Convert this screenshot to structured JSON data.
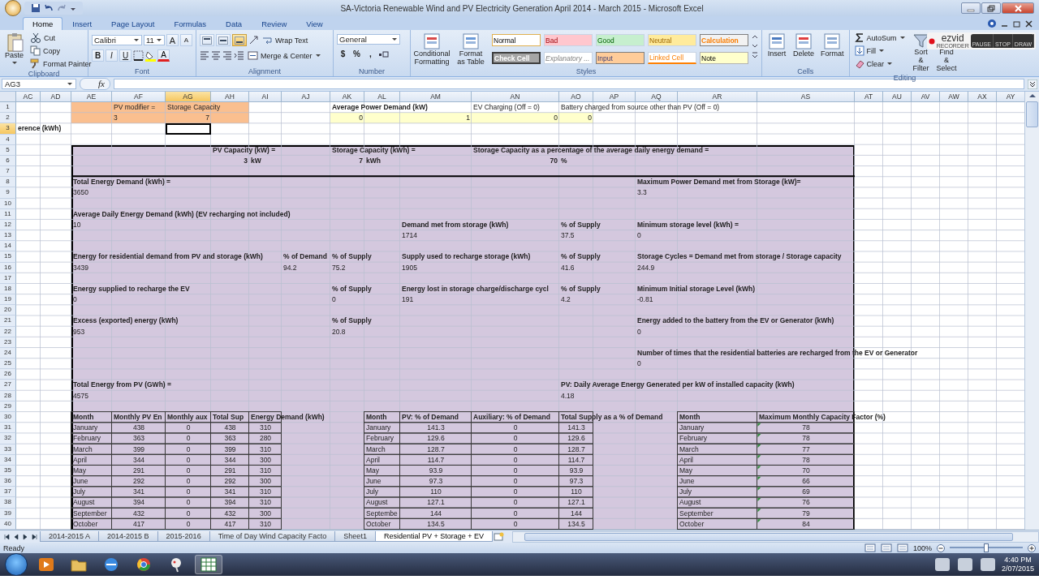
{
  "window": {
    "title": "SA-Victoria Renewable Wind and PV Electricity Generation April 2014 - March 2015 - Microsoft Excel"
  },
  "ribbon_tabs": [
    {
      "label": "Home",
      "selected": true
    },
    {
      "label": "Insert",
      "selected": false
    },
    {
      "label": "Page Layout",
      "selected": false
    },
    {
      "label": "Formulas",
      "selected": false
    },
    {
      "label": "Data",
      "selected": false
    },
    {
      "label": "Review",
      "selected": false
    },
    {
      "label": "View",
      "selected": false
    }
  ],
  "ribbon": {
    "clipboard": {
      "label": "Clipboard",
      "paste": "Paste",
      "actions": [
        "Cut",
        "Copy",
        "Format Painter"
      ]
    },
    "font": {
      "label": "Font",
      "family": "Calibri",
      "size": "11",
      "size_buttons": [
        "A",
        "A"
      ],
      "format_buttons": [
        "B",
        "I",
        "U"
      ],
      "font_color": "A"
    },
    "alignment": {
      "label": "Alignment",
      "vertical_align": [
        {
          "selected": false
        },
        {
          "selected": false
        },
        {
          "selected": true
        }
      ],
      "wrap": "Wrap Text",
      "merge": "Merge & Center"
    },
    "number": {
      "label": "Number",
      "format": "General",
      "symbols": [
        "$",
        "%",
        ","
      ]
    },
    "styles": {
      "label": "Styles",
      "buttons": [
        "Conditional Formatting",
        "Format as Table"
      ],
      "cell_styles": [
        {
          "label": "Normal",
          "kind": "normal"
        },
        {
          "label": "Bad",
          "kind": "bad"
        },
        {
          "label": "Good",
          "kind": "good"
        },
        {
          "label": "Neutral",
          "kind": "neutral"
        },
        {
          "label": "Calculation",
          "kind": "calculation"
        },
        {
          "label": "Check Cell",
          "kind": "check"
        },
        {
          "label": "Explanatory ...",
          "kind": "explanatory"
        },
        {
          "label": "Input",
          "kind": "input"
        },
        {
          "label": "Linked Cell",
          "kind": "linked"
        },
        {
          "label": "Note",
          "kind": "note"
        }
      ]
    },
    "cells": {
      "label": "Cells",
      "buttons": [
        "Insert",
        "Delete",
        "Format"
      ]
    },
    "editing": {
      "label": "Editing",
      "actions": [
        "AutoSum",
        "Fill",
        "Clear"
      ],
      "buttons": [
        "Sort & Filter",
        "Find & Select"
      ]
    }
  },
  "recorder": {
    "logo": "ezvid",
    "caption": "RECORDER",
    "buttons": [
      "PAUSE",
      "STOP",
      "DRAW"
    ]
  },
  "formula_bar": {
    "name_box": "AG3",
    "function_label": "fx"
  },
  "columns": [
    {
      "label": "AC",
      "selected": false
    },
    {
      "label": "AD",
      "selected": false
    },
    {
      "label": "AE",
      "selected": false
    },
    {
      "label": "AF",
      "selected": false
    },
    {
      "label": "AG",
      "selected": true
    },
    {
      "label": "AH",
      "selected": false
    },
    {
      "label": "AI",
      "selected": false
    },
    {
      "label": "AJ",
      "selected": false
    },
    {
      "label": "AK",
      "selected": false
    },
    {
      "label": "AL",
      "selected": false
    },
    {
      "label": "AM",
      "selected": false
    },
    {
      "label": "AN",
      "selected": false
    },
    {
      "label": "AO",
      "selected": false
    },
    {
      "label": "AP",
      "selected": false
    },
    {
      "label": "AQ",
      "selected": false
    },
    {
      "label": "AR",
      "selected": false
    },
    {
      "label": "AS",
      "selected": false
    },
    {
      "label": "AT",
      "selected": false
    },
    {
      "label": "AU",
      "selected": false
    },
    {
      "label": "AV",
      "selected": false
    },
    {
      "label": "AW",
      "selected": false
    },
    {
      "label": "AX",
      "selected": false
    },
    {
      "label": "AY",
      "selected": false
    }
  ],
  "rows": [
    {
      "label": "1",
      "selected": false,
      "cells": {
        "AE": {
          "kind": "fill",
          "color": "#fabf8f"
        },
        "AF": {
          "text": "PV modifier =",
          "kind": "text",
          "color": "#fabf8f"
        },
        "AG": {
          "text": "Storage Capacity",
          "kind": "text",
          "color": "#fabf8f"
        },
        "AH": {
          "kind": "fill",
          "color": "#fabf8f"
        },
        "AK": {
          "text": "Average Power Demand (kW)",
          "kind": "label"
        },
        "AN": {
          "text": "EV Charging (Off = 0)",
          "kind": "text"
        },
        "AO": {
          "text": "Battery charged from source other than PV (Off = 0)",
          "kind": "text"
        }
      }
    },
    {
      "label": "2",
      "selected": false,
      "cells": {
        "AE": {
          "kind": "fill",
          "color": "#fabf8f"
        },
        "AF": {
          "text": "3",
          "kind": "text",
          "color": "#fabf8f"
        },
        "AG": {
          "text": "7",
          "kind": "number",
          "color": "#fabf8f"
        },
        "AH": {
          "kind": "fill",
          "color": "#fabf8f"
        },
        "AK": {
          "text": "0",
          "kind": "number",
          "color": "#ffffcc"
        },
        "AL": {
          "kind": "fill",
          "color": "#ffffcc"
        },
        "AM": {
          "text": "1",
          "kind": "number",
          "color": "#ffffcc"
        },
        "AN": {
          "text": "0",
          "kind": "number",
          "color": "#ffffcc"
        },
        "AO": {
          "text": "0",
          "kind": "number",
          "color": "#ffffcc"
        }
      }
    },
    {
      "label": "3",
      "selected": true,
      "cells": {
        "AC": {
          "text": "erence (kWh)",
          "kind": "label"
        }
      }
    },
    {
      "label": "4",
      "selected": false
    },
    {
      "label": "5",
      "selected": false,
      "cells": {
        "AH": {
          "text": "PV Capacity (kW) =",
          "kind": "label"
        },
        "AK": {
          "text": "Storage Capacity (kWh) =",
          "kind": "label"
        },
        "AN": {
          "text": "Storage Capacity as a percentage of the average daily energy demand =",
          "kind": "label"
        }
      }
    },
    {
      "label": "6",
      "selected": false,
      "cells": {
        "AH": {
          "text": "3",
          "kind": "total"
        },
        "AI": {
          "text": "kW",
          "kind": "label"
        },
        "AK": {
          "text": "7",
          "kind": "total"
        },
        "AL": {
          "text": "kWh",
          "kind": "label"
        },
        "AN": {
          "text": "70",
          "kind": "total"
        },
        "AO": {
          "text": "%",
          "kind": "label"
        }
      }
    },
    {
      "label": "7",
      "selected": false
    },
    {
      "label": "8",
      "selected": false,
      "cells": {
        "AE": {
          "text": "Total Energy Demand (kWh) =",
          "kind": "label"
        },
        "AQ": {
          "text": "Maximum Power Demand met from Storage (kW)=",
          "kind": "label"
        }
      }
    },
    {
      "label": "9",
      "selected": false,
      "cells": {
        "AE": {
          "text": "3650",
          "kind": "text"
        },
        "AQ": {
          "text": "3.3",
          "kind": "text"
        }
      }
    },
    {
      "label": "10",
      "selected": false
    },
    {
      "label": "11",
      "selected": false,
      "cells": {
        "AE": {
          "text": "Average Daily Energy Demand (kWh) (EV recharging not included)",
          "kind": "label"
        }
      }
    },
    {
      "label": "12",
      "selected": false,
      "cells": {
        "AE": {
          "text": "10",
          "kind": "text"
        },
        "AM": {
          "text": "Demand met from storage (kWh)",
          "kind": "label"
        },
        "AO": {
          "text": "% of Supply",
          "kind": "label"
        },
        "AQ": {
          "text": "Minimum storage level (kWh) =",
          "kind": "label"
        }
      }
    },
    {
      "label": "13",
      "selected": false,
      "cells": {
        "AM": {
          "text": "1714",
          "kind": "text"
        },
        "AO": {
          "text": "37.5",
          "kind": "text"
        },
        "AQ": {
          "text": "0",
          "kind": "text"
        }
      }
    },
    {
      "label": "14",
      "selected": false
    },
    {
      "label": "15",
      "selected": false,
      "cells": {
        "AE": {
          "text": "Energy for residential demand from PV and storage (kWh)",
          "kind": "label"
        },
        "AJ": {
          "text": "% of Demand",
          "kind": "label"
        },
        "AK": {
          "text": "% of Supply",
          "kind": "label"
        },
        "AM": {
          "text": "Supply used to recharge storage (kWh)",
          "kind": "label"
        },
        "AO": {
          "text": "% of Supply",
          "kind": "label"
        },
        "AQ": {
          "text": "Storage Cycles = Demand met from storage / Storage capacity",
          "kind": "label"
        }
      }
    },
    {
      "label": "16",
      "selected": false,
      "cells": {
        "AE": {
          "text": "3439",
          "kind": "text"
        },
        "AJ": {
          "text": "94.2",
          "kind": "text"
        },
        "AK": {
          "text": "75.2",
          "kind": "text"
        },
        "AM": {
          "text": "1905",
          "kind": "text"
        },
        "AO": {
          "text": "41.6",
          "kind": "text"
        },
        "AQ": {
          "text": "244.9",
          "kind": "text"
        }
      }
    },
    {
      "label": "17",
      "selected": false
    },
    {
      "label": "18",
      "selected": false,
      "cells": {
        "AE": {
          "text": "Energy supplied to recharge the EV",
          "kind": "label"
        },
        "AK": {
          "text": "% of Supply",
          "kind": "label"
        },
        "AM": {
          "text": "Energy lost in storage charge/discharge cycl",
          "kind": "label"
        },
        "AO": {
          "text": "% of Supply",
          "kind": "label"
        },
        "AQ": {
          "text": "Minimum Initial storage Level (kWh)",
          "kind": "label"
        }
      }
    },
    {
      "label": "19",
      "selected": false,
      "cells": {
        "AE": {
          "text": "0",
          "kind": "text"
        },
        "AK": {
          "text": "0",
          "kind": "text"
        },
        "AM": {
          "text": "191",
          "kind": "text"
        },
        "AO": {
          "text": "4.2",
          "kind": "text"
        },
        "AQ": {
          "text": "-0.81",
          "kind": "text"
        }
      }
    },
    {
      "label": "20",
      "selected": false
    },
    {
      "label": "21",
      "selected": false,
      "cells": {
        "AE": {
          "text": "Excess (exported) energy (kWh)",
          "kind": "label"
        },
        "AK": {
          "text": "% of Supply",
          "kind": "label"
        },
        "AQ": {
          "text": "Energy added to the battery from the EV or Generator (kWh)",
          "kind": "label"
        }
      }
    },
    {
      "label": "22",
      "selected": false,
      "cells": {
        "AE": {
          "text": "953",
          "kind": "text"
        },
        "AK": {
          "text": "20.8",
          "kind": "text"
        },
        "AQ": {
          "text": "0",
          "kind": "text"
        }
      }
    },
    {
      "label": "23",
      "selected": false
    },
    {
      "label": "24",
      "selected": false,
      "cells": {
        "AQ": {
          "text": "Number of times that the residential batteries are recharged from the EV or Generator",
          "kind": "label"
        }
      }
    },
    {
      "label": "25",
      "selected": false,
      "cells": {
        "AQ": {
          "text": "0",
          "kind": "text"
        }
      }
    },
    {
      "label": "26",
      "selected": false
    },
    {
      "label": "27",
      "selected": false,
      "cells": {
        "AE": {
          "text": "Total Energy from PV (GWh) =",
          "kind": "label"
        },
        "AO": {
          "text": "PV: Daily Average Energy Generated per kW of installed capacity (kWh)",
          "kind": "label"
        }
      }
    },
    {
      "label": "28",
      "selected": false,
      "cells": {
        "AE": {
          "text": "4575",
          "kind": "text"
        },
        "AO": {
          "text": "4.18",
          "kind": "text"
        }
      }
    },
    {
      "label": "29",
      "selected": false
    },
    {
      "label": "30",
      "selected": false,
      "cells": {
        "AE": {
          "text": "Month",
          "kind": "head"
        },
        "AF": {
          "text": "Monthly PV En",
          "kind": "head"
        },
        "AG": {
          "text": "Monthly aux",
          "kind": "head"
        },
        "AH": {
          "text": "Total Sup",
          "kind": "head"
        },
        "AI": {
          "text": "Energy Demand (kWh)",
          "kind": "head"
        },
        "AL": {
          "text": "Month",
          "kind": "head"
        },
        "AM": {
          "text": "PV: % of Demand",
          "kind": "head"
        },
        "AN": {
          "text": "Auxiliary: % of Demand",
          "kind": "head"
        },
        "AO": {
          "text": "Total Supply as a % of Demand",
          "kind": "head"
        },
        "AR": {
          "text": "Month",
          "kind": "head"
        },
        "AS": {
          "text": "Maximum Monthly Capacity Factor (%)",
          "kind": "head"
        }
      }
    },
    {
      "label": "31",
      "selected": false,
      "cells": {
        "AE": {
          "text": "January",
          "kind": "entry"
        },
        "AF": {
          "text": "438",
          "kind": "figure"
        },
        "AG": {
          "text": "0",
          "kind": "figure"
        },
        "AH": {
          "text": "438",
          "kind": "figure"
        },
        "AI": {
          "text": "310",
          "kind": "figure"
        },
        "AL": {
          "text": "January",
          "kind": "entry"
        },
        "AM": {
          "text": "141.3",
          "kind": "figure"
        },
        "AN": {
          "text": "0",
          "kind": "figure"
        },
        "AO": {
          "text": "141.3",
          "kind": "figure"
        },
        "AR": {
          "text": "January",
          "kind": "entry"
        },
        "AS": {
          "text": "78",
          "kind": "flagged"
        }
      }
    },
    {
      "label": "32",
      "selected": false,
      "cells": {
        "AE": {
          "text": "February",
          "kind": "entry"
        },
        "AF": {
          "text": "363",
          "kind": "figure"
        },
        "AG": {
          "text": "0",
          "kind": "figure"
        },
        "AH": {
          "text": "363",
          "kind": "figure"
        },
        "AI": {
          "text": "280",
          "kind": "figure"
        },
        "AL": {
          "text": "February",
          "kind": "entry"
        },
        "AM": {
          "text": "129.6",
          "kind": "figure"
        },
        "AN": {
          "text": "0",
          "kind": "figure"
        },
        "AO": {
          "text": "129.6",
          "kind": "figure"
        },
        "AR": {
          "text": "February",
          "kind": "entry"
        },
        "AS": {
          "text": "78",
          "kind": "flagged"
        }
      }
    },
    {
      "label": "33",
      "selected": false,
      "cells": {
        "AE": {
          "text": "March",
          "kind": "entry"
        },
        "AF": {
          "text": "399",
          "kind": "figure"
        },
        "AG": {
          "text": "0",
          "kind": "figure"
        },
        "AH": {
          "text": "399",
          "kind": "figure"
        },
        "AI": {
          "text": "310",
          "kind": "figure"
        },
        "AL": {
          "text": "March",
          "kind": "entry"
        },
        "AM": {
          "text": "128.7",
          "kind": "figure"
        },
        "AN": {
          "text": "0",
          "kind": "figure"
        },
        "AO": {
          "text": "128.7",
          "kind": "figure"
        },
        "AR": {
          "text": "March",
          "kind": "entry"
        },
        "AS": {
          "text": "77",
          "kind": "flagged"
        }
      }
    },
    {
      "label": "34",
      "selected": false,
      "cells": {
        "AE": {
          "text": "April",
          "kind": "entry"
        },
        "AF": {
          "text": "344",
          "kind": "figure"
        },
        "AG": {
          "text": "0",
          "kind": "figure"
        },
        "AH": {
          "text": "344",
          "kind": "figure"
        },
        "AI": {
          "text": "300",
          "kind": "figure"
        },
        "AL": {
          "text": "April",
          "kind": "entry"
        },
        "AM": {
          "text": "114.7",
          "kind": "figure"
        },
        "AN": {
          "text": "0",
          "kind": "figure"
        },
        "AO": {
          "text": "114.7",
          "kind": "figure"
        },
        "AR": {
          "text": "April",
          "kind": "entry"
        },
        "AS": {
          "text": "78",
          "kind": "flagged"
        }
      }
    },
    {
      "label": "35",
      "selected": false,
      "cells": {
        "AE": {
          "text": "May",
          "kind": "entry"
        },
        "AF": {
          "text": "291",
          "kind": "figure"
        },
        "AG": {
          "text": "0",
          "kind": "figure"
        },
        "AH": {
          "text": "291",
          "kind": "figure"
        },
        "AI": {
          "text": "310",
          "kind": "figure"
        },
        "AL": {
          "text": "May",
          "kind": "entry"
        },
        "AM": {
          "text": "93.9",
          "kind": "figure"
        },
        "AN": {
          "text": "0",
          "kind": "figure"
        },
        "AO": {
          "text": "93.9",
          "kind": "figure"
        },
        "AR": {
          "text": "May",
          "kind": "entry"
        },
        "AS": {
          "text": "70",
          "kind": "flagged"
        }
      }
    },
    {
      "label": "36",
      "selected": false,
      "cells": {
        "AE": {
          "text": "June",
          "kind": "entry"
        },
        "AF": {
          "text": "292",
          "kind": "figure"
        },
        "AG": {
          "text": "0",
          "kind": "figure"
        },
        "AH": {
          "text": "292",
          "kind": "figure"
        },
        "AI": {
          "text": "300",
          "kind": "figure"
        },
        "AL": {
          "text": "June",
          "kind": "entry"
        },
        "AM": {
          "text": "97.3",
          "kind": "figure"
        },
        "AN": {
          "text": "0",
          "kind": "figure"
        },
        "AO": {
          "text": "97.3",
          "kind": "figure"
        },
        "AR": {
          "text": "June",
          "kind": "entry"
        },
        "AS": {
          "text": "66",
          "kind": "flagged"
        }
      }
    },
    {
      "label": "37",
      "selected": false,
      "cells": {
        "AE": {
          "text": "July",
          "kind": "entry"
        },
        "AF": {
          "text": "341",
          "kind": "figure"
        },
        "AG": {
          "text": "0",
          "kind": "figure"
        },
        "AH": {
          "text": "341",
          "kind": "figure"
        },
        "AI": {
          "text": "310",
          "kind": "figure"
        },
        "AL": {
          "text": "July",
          "kind": "entry"
        },
        "AM": {
          "text": "110",
          "kind": "figure"
        },
        "AN": {
          "text": "0",
          "kind": "figure"
        },
        "AO": {
          "text": "110",
          "kind": "figure"
        },
        "AR": {
          "text": "July",
          "kind": "entry"
        },
        "AS": {
          "text": "69",
          "kind": "flagged"
        }
      }
    },
    {
      "label": "38",
      "selected": false,
      "cells": {
        "AE": {
          "text": "August",
          "kind": "entry"
        },
        "AF": {
          "text": "394",
          "kind": "figure"
        },
        "AG": {
          "text": "0",
          "kind": "figure"
        },
        "AH": {
          "text": "394",
          "kind": "figure"
        },
        "AI": {
          "text": "310",
          "kind": "figure"
        },
        "AL": {
          "text": "August",
          "kind": "entry"
        },
        "AM": {
          "text": "127.1",
          "kind": "figure"
        },
        "AN": {
          "text": "0",
          "kind": "figure"
        },
        "AO": {
          "text": "127.1",
          "kind": "figure"
        },
        "AR": {
          "text": "August",
          "kind": "entry"
        },
        "AS": {
          "text": "76",
          "kind": "flagged"
        }
      }
    },
    {
      "label": "39",
      "selected": false,
      "cells": {
        "AE": {
          "text": "September",
          "kind": "entry"
        },
        "AF": {
          "text": "432",
          "kind": "figure"
        },
        "AG": {
          "text": "0",
          "kind": "figure"
        },
        "AH": {
          "text": "432",
          "kind": "figure"
        },
        "AI": {
          "text": "300",
          "kind": "figure"
        },
        "AL": {
          "text": "Septembe",
          "kind": "entry"
        },
        "AM": {
          "text": "144",
          "kind": "figure"
        },
        "AN": {
          "text": "0",
          "kind": "figure"
        },
        "AO": {
          "text": "144",
          "kind": "figure"
        },
        "AR": {
          "text": "September",
          "kind": "entry"
        },
        "AS": {
          "text": "79",
          "kind": "flagged"
        }
      }
    },
    {
      "label": "40",
      "selected": false,
      "cells": {
        "AE": {
          "text": "October",
          "kind": "entry"
        },
        "AF": {
          "text": "417",
          "kind": "figure"
        },
        "AG": {
          "text": "0",
          "kind": "figure"
        },
        "AH": {
          "text": "417",
          "kind": "figure"
        },
        "AI": {
          "text": "310",
          "kind": "figure"
        },
        "AL": {
          "text": "October",
          "kind": "entry"
        },
        "AM": {
          "text": "134.5",
          "kind": "figure"
        },
        "AN": {
          "text": "0",
          "kind": "figure"
        },
        "AO": {
          "text": "134.5",
          "kind": "figure"
        },
        "AR": {
          "text": "October",
          "kind": "entry"
        },
        "AS": {
          "text": "84",
          "kind": "flagged"
        }
      }
    }
  ],
  "sheet_tabs": [
    {
      "label": "2014-2015 A",
      "selected": false
    },
    {
      "label": "2014-2015 B",
      "selected": false
    },
    {
      "label": "2015-2016",
      "selected": false
    },
    {
      "label": "Time of Day Wind Capacity Facto",
      "selected": false
    },
    {
      "label": "Sheet1",
      "selected": false
    },
    {
      "label": "Residential PV + Storage + EV",
      "selected": true
    }
  ],
  "status_bar": {
    "status": "Ready",
    "zoom": "100%",
    "zoom_slider": {
      "level": 0.5
    }
  },
  "taskbar": {
    "time": "4:40 PM",
    "date": "2/07/2015"
  }
}
